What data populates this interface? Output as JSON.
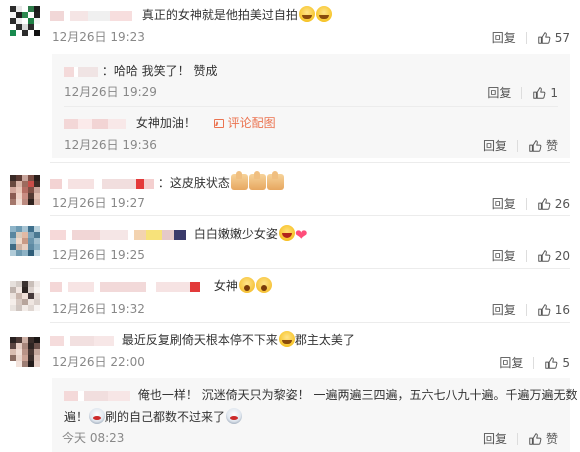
{
  "comments": [
    {
      "text": "真正的女神就是他拍美过自拍",
      "time": "12月26日 19:23",
      "reply_label": "回复",
      "likes": "57",
      "sub": [
        {
          "text": "：哈哈 我笑了！ 赞成",
          "time": "12月26日 19:29",
          "reply_label": "回复",
          "likes": "1"
        },
        {
          "text": "女神加油！",
          "link": "评论配图",
          "time": "12月26日 19:36",
          "reply_label": "回复",
          "likes": "赞"
        }
      ]
    },
    {
      "text": "：这皮肤状态",
      "time": "12月26日 19:27",
      "reply_label": "回复",
      "likes": "26"
    },
    {
      "text": "白白嫩嫩少女姿",
      "time": "12月26日 19:25",
      "reply_label": "回复",
      "likes": "20"
    },
    {
      "text": "女神",
      "time": "12月26日 19:32",
      "reply_label": "回复",
      "likes": "16"
    },
    {
      "text": "最近反复刷倚天根本停不下来",
      "text2": "郡主太美了",
      "time": "12月26日 22:00",
      "reply_label": "回复",
      "likes": "5",
      "sub": [
        {
          "text": "俺也一样！ 沉迷倚天只为黎姿！ 一遍两遍三四遍，五六七八九十遍。千遍万遍无数",
          "text_line2a": "遍！",
          "text_line2b": "刷的自己都数不过来了",
          "time": "今天 08:23",
          "reply_label": "回复",
          "likes": "赞"
        }
      ]
    }
  ],
  "icons": {
    "like": "thumbs-up-icon",
    "image": "image-icon"
  },
  "colors": {
    "link": "#eb7350",
    "time": "#888888",
    "sub_bg": "#f7f7f7"
  }
}
